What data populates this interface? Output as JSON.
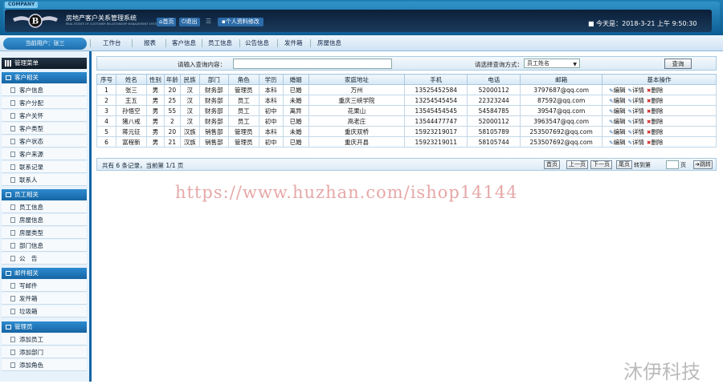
{
  "header": {
    "company_tag": "COMPANY",
    "system_title": "房地产客户关系管理系统",
    "system_subtitle": "REAL ESTATE OF CUSTOMER RELATIONSHIP MANAGEMENT SYSTEM",
    "home_label": "首页",
    "exit_label": "退出",
    "profile_label": "个人资料修改",
    "today_label": "今天是：2018-3-21 上午 9:50:30"
  },
  "nav": {
    "current_user": "当前用户：张三",
    "items": [
      "工作台",
      "报表",
      "客户信息",
      "员工信息",
      "公告信息",
      "发件箱",
      "房屋信息"
    ]
  },
  "sidebar": {
    "title": "管理菜单",
    "groups": [
      {
        "label": "客户相关",
        "items": [
          "客户信息",
          "客户分配",
          "客户关怀",
          "客户类型",
          "客户状态",
          "客户来源",
          "联系记录",
          "联系人"
        ]
      },
      {
        "label": "员工相关",
        "items": [
          "员工信息",
          "房屋信息",
          "房屋类型",
          "部门信息",
          "公　告"
        ]
      },
      {
        "label": "邮件相关",
        "items": [
          "写邮件",
          "发件箱",
          "垃圾箱"
        ]
      },
      {
        "label": "管理员",
        "items": [
          "添加员工",
          "添加部门",
          "添加角色"
        ]
      }
    ]
  },
  "search": {
    "label": "请输入查询内容：",
    "input_value": "",
    "mode_label": "请选择查询方式：",
    "mode_value": "员工姓名",
    "query_button": "查询"
  },
  "table": {
    "headers": [
      "序号",
      "姓名",
      "性别",
      "年龄",
      "民族",
      "部门",
      "角色",
      "学历",
      "婚姻",
      "家庭地址",
      "手机",
      "电话",
      "邮箱",
      "基本操作"
    ],
    "rows": [
      [
        "1",
        "张三",
        "男",
        "20",
        "汉",
        "财务部",
        "管理员",
        "本科",
        "已婚",
        "万州",
        "13525452584",
        "52000112",
        "3797687@qq.com"
      ],
      [
        "2",
        "王五",
        "男",
        "25",
        "汉",
        "财务部",
        "员工",
        "本科",
        "未婚",
        "重庆三峡学院",
        "13254545454",
        "22323244",
        "87592@qq.com"
      ],
      [
        "3",
        "孙悟空",
        "男",
        "55",
        "汉",
        "财务部",
        "员工",
        "初中",
        "离异",
        "花果山",
        "13545454545",
        "54584785",
        "39547@qq.com"
      ],
      [
        "4",
        "猪八戒",
        "男",
        "2",
        "汉",
        "财务部",
        "员工",
        "初中",
        "已婚",
        "高老庄",
        "13544477747",
        "52000112",
        "3963547@qq.com"
      ],
      [
        "5",
        "蒋元征",
        "男",
        "20",
        "汉族",
        "销售部",
        "管理员",
        "本科",
        "未婚",
        "重庆双桥",
        "15923219017",
        "58105789",
        "253507692@qq.com"
      ],
      [
        "6",
        "富程新",
        "男",
        "21",
        "汉族",
        "销售部",
        "管理员",
        "初中",
        "已婚",
        "重庆开县",
        "15923219011",
        "58105744",
        "253507692@qq.com"
      ]
    ],
    "ops": {
      "edit": "编辑",
      "detail": "详情",
      "delete": "删除"
    }
  },
  "pager": {
    "info": "共有 6 条记录，当前第 1/1 页",
    "first": "首页",
    "prev": "上一页",
    "next": "下一页",
    "last": "尾页",
    "jump_label": "转到第",
    "page_unit": "页",
    "go": "跳转"
  },
  "watermark": "https://www.huzhan.com/ishop14144",
  "corner_mark": "沐伊科技"
}
